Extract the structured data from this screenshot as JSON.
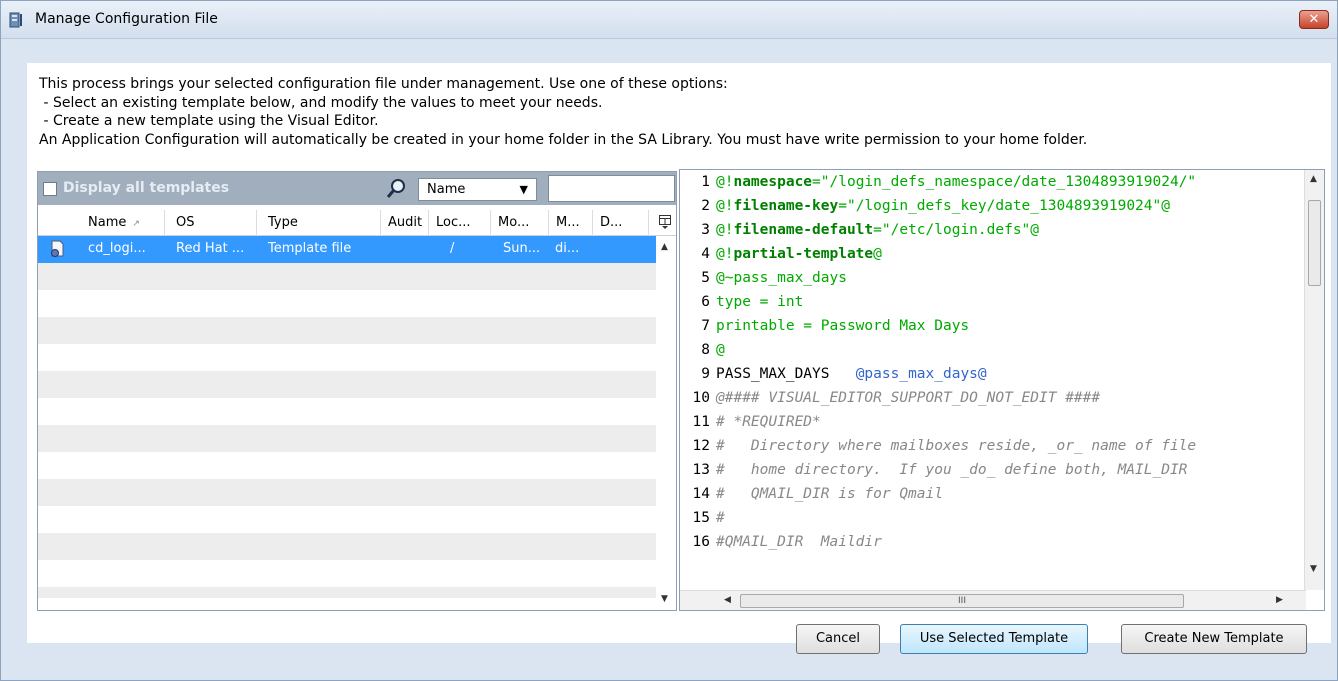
{
  "window": {
    "title": "Manage Configuration File",
    "close_label": "✕"
  },
  "instructions": {
    "line1": "This process brings your selected configuration file under management. Use one of these options:",
    "line2": " - Select an existing template below, and modify the values to meet your needs.",
    "line3": " - Create a new template using the Visual Editor.",
    "line4": "An Application Configuration will automatically be created in your home folder in the SA Library. You must have write permission to your home folder."
  },
  "templates_panel": {
    "display_all_label": "Display all templates",
    "search_field_value": "Name",
    "filter_value": "",
    "columns": [
      "Name",
      "OS",
      "Type",
      "Audit",
      "Loc...",
      "Mo...",
      "M...",
      "D..."
    ],
    "rows": [
      {
        "name": "cd_logi...",
        "os": "Red Hat ...",
        "type": "Template file",
        "audit": "",
        "loc": "/",
        "mo": "Sun...",
        "m": "di...",
        "d": ""
      }
    ]
  },
  "editor": {
    "lines": [
      {
        "n": "1",
        "a": "@!",
        "b": "namespace",
        "c": "=\"/login_defs_namespace/date_1304893919024/\""
      },
      {
        "n": "2",
        "a": "@!",
        "b": "filename-key",
        "c": "=\"/login_defs_key/date_1304893919024\"@"
      },
      {
        "n": "3",
        "a": "@!",
        "b": "filename-default",
        "c": "=\"/etc/login.defs\"@"
      },
      {
        "n": "4",
        "a": "@!",
        "b": "partial-template",
        "c": "@"
      },
      {
        "n": "5",
        "a": "@~pass_max_days"
      },
      {
        "n": "6",
        "a": "type = int"
      },
      {
        "n": "7",
        "a": "printable = Password Max Days"
      },
      {
        "n": "8",
        "a": "@"
      },
      {
        "n": "9",
        "a": "PASS_MAX_DAYS   ",
        "v": "@pass_max_days@"
      },
      {
        "n": "10",
        "cm": "@#### VISUAL_EDITOR_SUPPORT_DO_NOT_EDIT ####"
      },
      {
        "n": "11",
        "cm": "# *REQUIRED*"
      },
      {
        "n": "12",
        "cm": "#   Directory where mailboxes reside, _or_ name of file"
      },
      {
        "n": "13",
        "cm": "#   home directory.  If you _do_ define both, MAIL_DIR"
      },
      {
        "n": "14",
        "cm": "#   QMAIL_DIR is for Qmail"
      },
      {
        "n": "15",
        "cm": "#"
      },
      {
        "n": "16",
        "cm": "#QMAIL_DIR  Maildir"
      }
    ],
    "hscroll_grip": "III"
  },
  "buttons": {
    "cancel": "Cancel",
    "use_selected": "Use Selected Template",
    "create_new": "Create New Template"
  }
}
